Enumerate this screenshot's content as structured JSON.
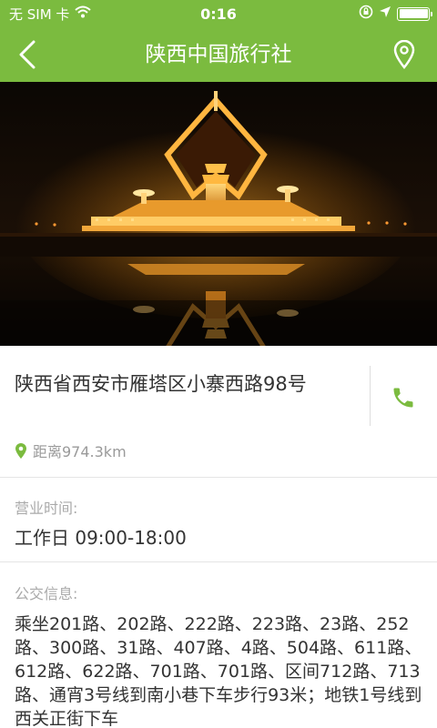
{
  "status_bar": {
    "carrier": "无 SIM 卡",
    "time": "0:16"
  },
  "nav": {
    "title": "陕西中国旅行社",
    "back_icon": "chevron-left-icon",
    "location_icon": "map-pin-icon"
  },
  "place": {
    "address": "陕西省西安市雁塔区小寨西路98号",
    "distance": "距离974.3km",
    "phone_icon": "phone-icon"
  },
  "hours": {
    "label": "营业时间:",
    "value": "工作日 09:00-18:00"
  },
  "bus": {
    "label": "公交信息:",
    "value": "乘坐201路、202路、222路、223路、23路、252路、300路、31路、407路、4路、504路、611路、612路、622路、701路、701路、区间712路、713路、通宵3号线到南小巷下车步行93米；地铁1号线到西关正街下车"
  },
  "colors": {
    "brand_green": "#7bbb3f",
    "secondary_text": "#9a9a9a"
  }
}
